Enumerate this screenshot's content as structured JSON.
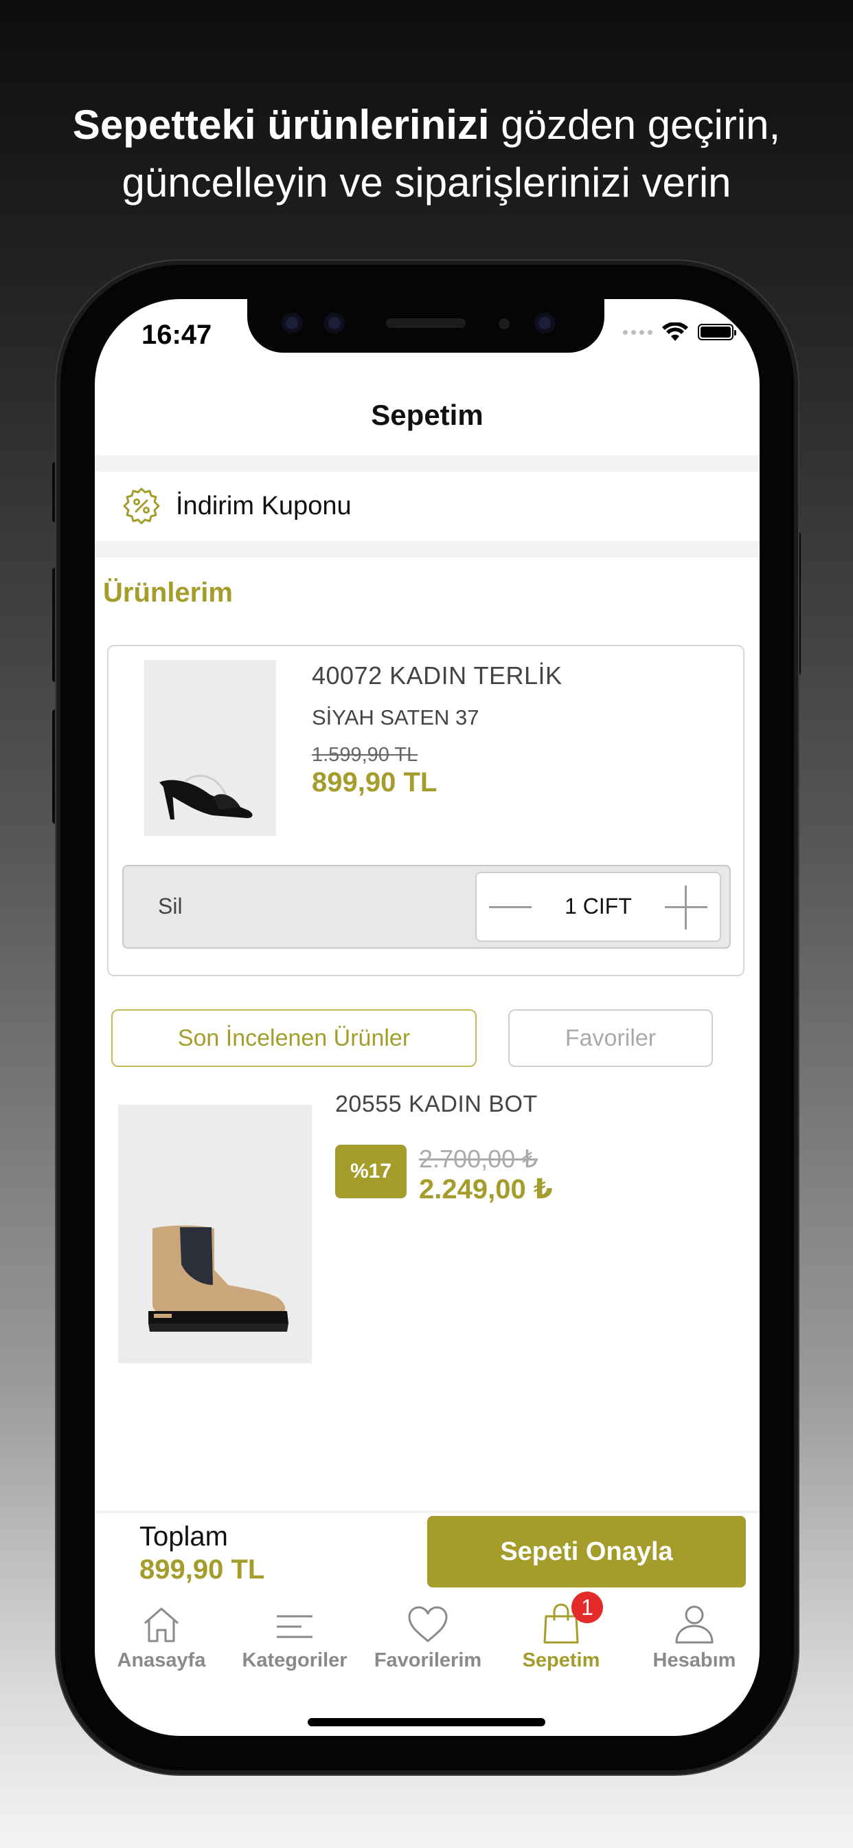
{
  "headline": {
    "bold": "Sepetteki ürünlerinizi",
    "line1_rest": " gözden geçirin,",
    "line2": "güncelleyin ve siparişlerinizi verin"
  },
  "status_bar": {
    "time": "16:47"
  },
  "nav": {
    "title": "Sepetim"
  },
  "coupon": {
    "label": "İndirim Kuponu",
    "icon": "discount-badge-icon"
  },
  "section": {
    "title": "Ürünlerim"
  },
  "cart_item": {
    "name": "40072 KADIN TERLİK",
    "variant": "SİYAH SATEN 37",
    "old_price": "1.599,90 TL",
    "price": "899,90 TL",
    "remove_label": "Sil",
    "quantity": "1 CIFT"
  },
  "tabs": {
    "recent": "Son İncelenen Ürünler",
    "favorites": "Favoriler"
  },
  "recent_item": {
    "name": "20555 KADIN BOT",
    "discount": "%17",
    "old_price": "2.700,00 ₺",
    "price": "2.249,00 ₺"
  },
  "summary": {
    "total_label": "Toplam",
    "total_value": "899,90 TL",
    "confirm_label": "Sepeti Onayla"
  },
  "tabbar": {
    "items": [
      {
        "label": "Anasayfa",
        "icon": "home-icon"
      },
      {
        "label": "Kategoriler",
        "icon": "menu-lines-icon"
      },
      {
        "label": "Favorilerim",
        "icon": "heart-icon"
      },
      {
        "label": "Sepetim",
        "icon": "shopping-bag-icon",
        "badge": "1",
        "active": true
      },
      {
        "label": "Hesabım",
        "icon": "user-icon"
      }
    ]
  },
  "colors": {
    "accent": "#a49d2b",
    "badge": "#e42a2a"
  }
}
